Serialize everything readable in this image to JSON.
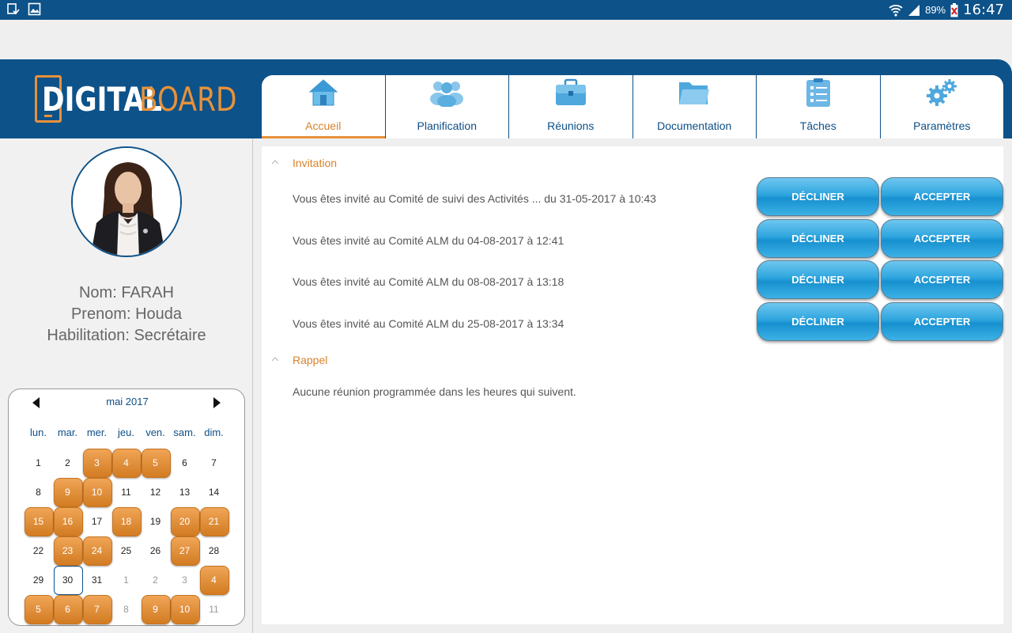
{
  "status_bar": {
    "battery": "89%",
    "time": "16:47",
    "icons": [
      "notification-icon",
      "gallery-icon",
      "wifi-icon",
      "signal-icon",
      "battery-icon"
    ]
  },
  "logo": {
    "part1": "DIGITAL",
    "part2": "BOARD"
  },
  "tabs": [
    {
      "label": "Accueil",
      "icon": "home-icon",
      "active": true
    },
    {
      "label": "Planification",
      "icon": "people-icon",
      "active": false
    },
    {
      "label": "Réunions",
      "icon": "briefcase-icon",
      "active": false
    },
    {
      "label": "Documentation",
      "icon": "folder-icon",
      "active": false
    },
    {
      "label": "Tâches",
      "icon": "checklist-icon",
      "active": false
    },
    {
      "label": "Paramètres",
      "icon": "gears-icon",
      "active": false
    }
  ],
  "profile": {
    "nom": "Nom: FARAH",
    "prenom": "Prenom: Houda",
    "habilitation": "Habilitation: Secrétaire"
  },
  "calendar": {
    "month_label": "mai 2017",
    "weekdays": [
      "lun.",
      "mar.",
      "mer.",
      "jeu.",
      "ven.",
      "sam.",
      "dim."
    ],
    "days": [
      {
        "d": "1",
        "ev": false,
        "other": false
      },
      {
        "d": "2",
        "ev": false,
        "other": false
      },
      {
        "d": "3",
        "ev": true,
        "other": false
      },
      {
        "d": "4",
        "ev": true,
        "other": false
      },
      {
        "d": "5",
        "ev": true,
        "other": false
      },
      {
        "d": "6",
        "ev": false,
        "other": false
      },
      {
        "d": "7",
        "ev": false,
        "other": false
      },
      {
        "d": "8",
        "ev": false,
        "other": false
      },
      {
        "d": "9",
        "ev": true,
        "other": false
      },
      {
        "d": "10",
        "ev": true,
        "other": false
      },
      {
        "d": "11",
        "ev": false,
        "other": false
      },
      {
        "d": "12",
        "ev": false,
        "other": false
      },
      {
        "d": "13",
        "ev": false,
        "other": false
      },
      {
        "d": "14",
        "ev": false,
        "other": false
      },
      {
        "d": "15",
        "ev": true,
        "other": false
      },
      {
        "d": "16",
        "ev": true,
        "other": false
      },
      {
        "d": "17",
        "ev": false,
        "other": false
      },
      {
        "d": "18",
        "ev": true,
        "other": false
      },
      {
        "d": "19",
        "ev": false,
        "other": false
      },
      {
        "d": "20",
        "ev": true,
        "other": false
      },
      {
        "d": "21",
        "ev": true,
        "other": false
      },
      {
        "d": "22",
        "ev": false,
        "other": false
      },
      {
        "d": "23",
        "ev": true,
        "other": false
      },
      {
        "d": "24",
        "ev": true,
        "other": false
      },
      {
        "d": "25",
        "ev": false,
        "other": false
      },
      {
        "d": "26",
        "ev": false,
        "other": false
      },
      {
        "d": "27",
        "ev": true,
        "other": false
      },
      {
        "d": "28",
        "ev": false,
        "other": false
      },
      {
        "d": "29",
        "ev": false,
        "other": false
      },
      {
        "d": "30",
        "ev": false,
        "other": false,
        "today": true
      },
      {
        "d": "31",
        "ev": false,
        "other": false
      },
      {
        "d": "1",
        "ev": false,
        "other": true
      },
      {
        "d": "2",
        "ev": false,
        "other": true
      },
      {
        "d": "3",
        "ev": false,
        "other": true
      },
      {
        "d": "4",
        "ev": true,
        "other": true
      },
      {
        "d": "5",
        "ev": true,
        "other": true
      },
      {
        "d": "6",
        "ev": true,
        "other": true
      },
      {
        "d": "7",
        "ev": true,
        "other": true
      },
      {
        "d": "8",
        "ev": false,
        "other": true
      },
      {
        "d": "9",
        "ev": true,
        "other": true
      },
      {
        "d": "10",
        "ev": true,
        "other": true
      },
      {
        "d": "11",
        "ev": false,
        "other": true
      }
    ]
  },
  "invitation": {
    "title": "Invitation",
    "decline_label": "DÉCLINER",
    "accept_label": "ACCEPTER",
    "items": [
      "Vous êtes invité au Comité de suivi des Activités ... du 31-05-2017 à 10:43",
      "Vous êtes invité au Comité ALM du 04-08-2017 à 12:41",
      "Vous êtes invité au Comité ALM du 08-08-2017 à 13:18",
      "Vous êtes invité au Comité ALM du 25-08-2017 à 13:34"
    ]
  },
  "rappel": {
    "title": "Rappel",
    "message": "Aucune réunion programmée dans les heures qui suivent."
  },
  "colors": {
    "primary": "#0d5289",
    "accent": "#e8913a",
    "button": "#2ea5de"
  }
}
